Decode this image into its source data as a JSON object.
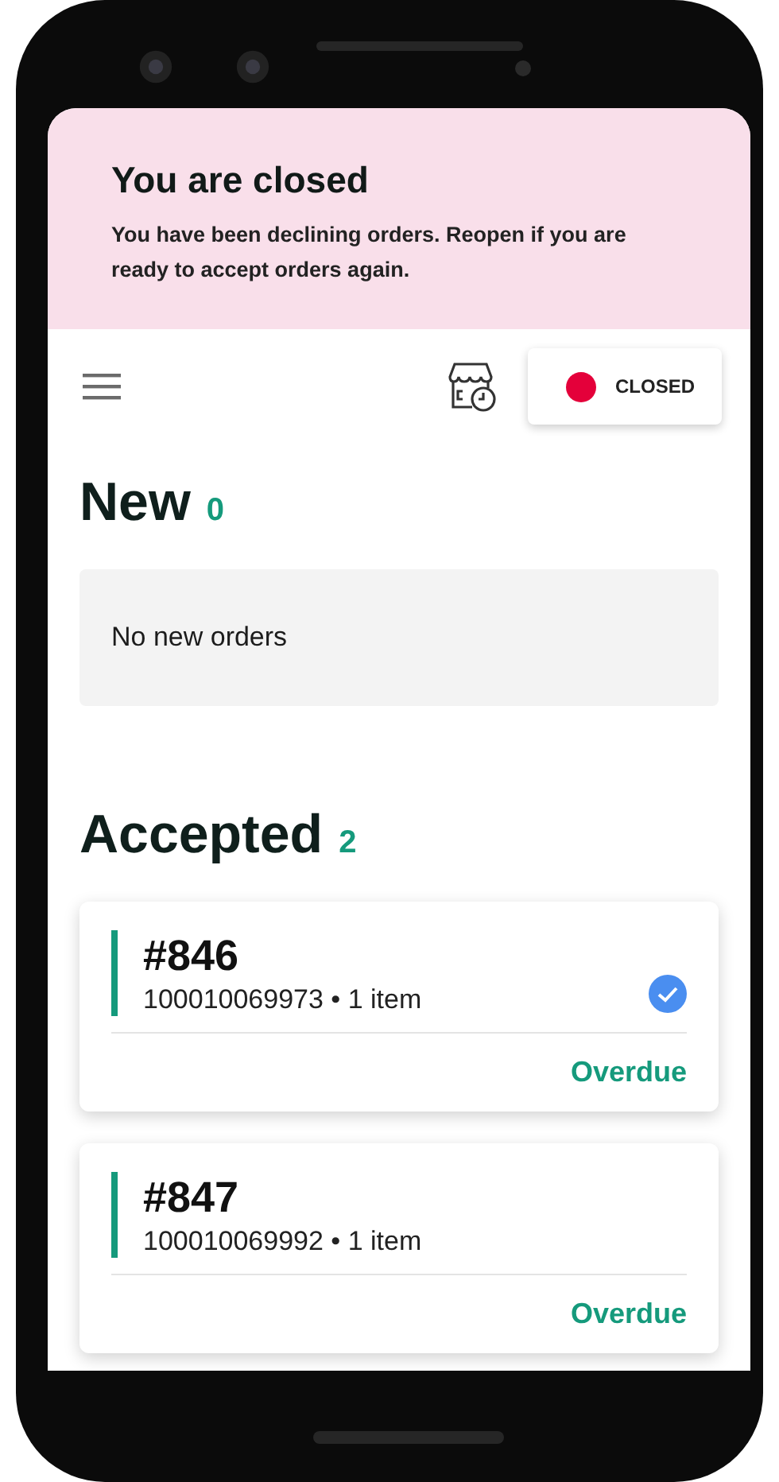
{
  "banner": {
    "title": "You are closed",
    "message": "You have been declining orders. Reopen if you are ready to accept orders again."
  },
  "toolbar": {
    "status": {
      "label": "CLOSED",
      "open": false
    }
  },
  "sections": [
    {
      "title": "New",
      "count": "0",
      "empty_text": "No new orders"
    },
    {
      "title": "Accepted",
      "count": "2",
      "orders": [
        {
          "number": "#846",
          "details": "100010069973 • 1 item",
          "checked": true,
          "status": "Overdue"
        },
        {
          "number": "#847",
          "details": "100010069992 • 1 item",
          "checked": false,
          "status": "Overdue"
        }
      ]
    }
  ]
}
